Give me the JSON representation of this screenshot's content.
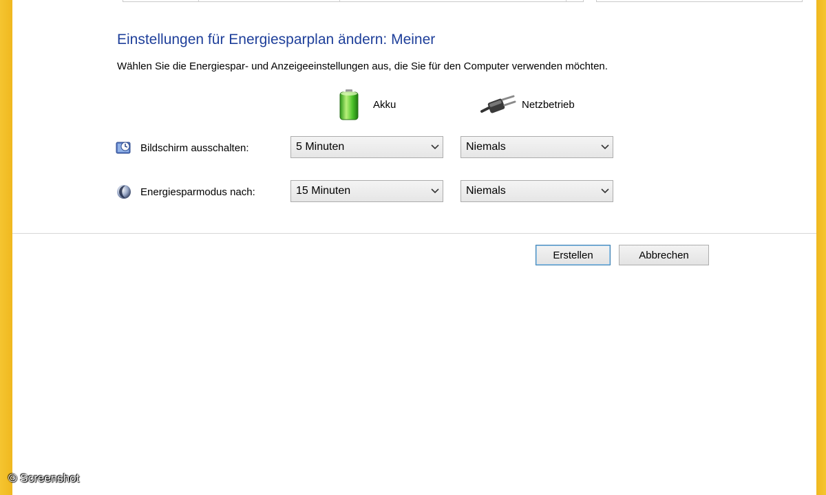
{
  "header": {
    "title": "Einstellungen für Energiesparplan ändern: Meiner",
    "subtitle": "Wählen Sie die Energiespar- und Anzeigeeinstellungen aus, die Sie für den Computer verwenden möchten."
  },
  "columns": {
    "battery": {
      "label": "Akku",
      "icon": "battery-icon"
    },
    "plugged": {
      "label": "Netzbetrieb",
      "icon": "power-plug-icon"
    }
  },
  "settings": [
    {
      "label": "Bildschirm ausschalten:",
      "icon": "display-off-icon",
      "battery_value": "5 Minuten",
      "plugged_value": "Niemals"
    },
    {
      "label": "Energiesparmodus nach:",
      "icon": "sleep-moon-icon",
      "battery_value": "15 Minuten",
      "plugged_value": "Niemals"
    }
  ],
  "buttons": {
    "create": "Erstellen",
    "cancel": "Abbrechen"
  },
  "watermark": "© Screenshot",
  "colors": {
    "title": "#1e3f9a",
    "window_frame": "#f2c94a",
    "default_button_border": "#3c7fb1"
  }
}
